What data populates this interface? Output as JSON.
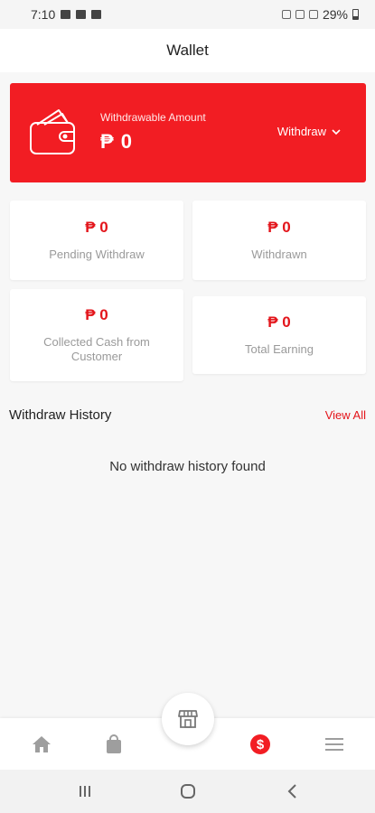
{
  "status_bar": {
    "time": "7:10",
    "battery": "29%"
  },
  "header": {
    "title": "Wallet"
  },
  "wallet": {
    "label": "Withdrawable Amount",
    "amount": "₱ 0",
    "withdraw_label": "Withdraw"
  },
  "stats": [
    {
      "value": "₱ 0",
      "label": "Pending Withdraw"
    },
    {
      "value": "₱ 0",
      "label": "Withdrawn"
    },
    {
      "value": "₱ 0",
      "label": "Collected Cash from Customer"
    },
    {
      "value": "₱ 0",
      "label": "Total Earning"
    }
  ],
  "history": {
    "title": "Withdraw History",
    "view_all": "View All",
    "empty": "No withdraw history found"
  },
  "bottom_nav": {
    "items": [
      "home-icon",
      "shopping-bag-icon",
      "store-icon",
      "dollar-icon",
      "menu-icon"
    ],
    "active": "dollar-icon"
  },
  "colors": {
    "accent": "#f21d23",
    "inactive_icon": "#9e9e9e"
  }
}
